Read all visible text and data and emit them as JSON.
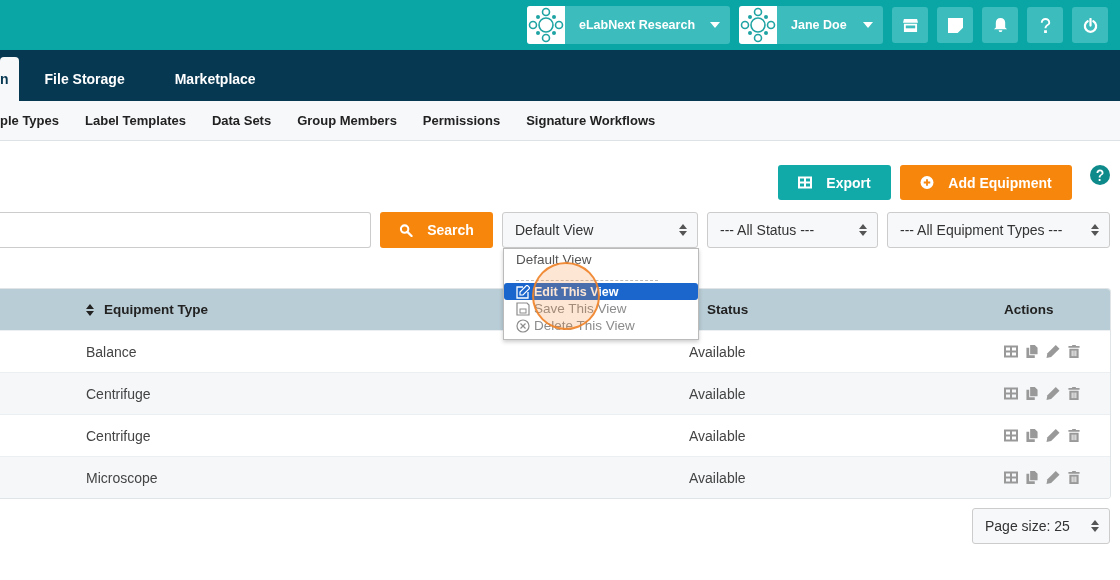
{
  "header": {
    "org": {
      "label": "eLabNext Research"
    },
    "user": {
      "label": "Jane Doe"
    }
  },
  "nav_tabs": [
    {
      "label": "n",
      "selected": true
    },
    {
      "label": "File Storage",
      "selected": false
    },
    {
      "label": "Marketplace",
      "selected": false
    }
  ],
  "sub_nav": [
    "ple Types",
    "Label Templates",
    "Data Sets",
    "Group Members",
    "Permissions",
    "Signature Workflows"
  ],
  "toolbar": {
    "export_button": "Export",
    "add_button": "Add Equipment"
  },
  "filters": {
    "search_button": "Search",
    "view_select": "Default View",
    "status_select": "--- All Status ---",
    "type_select": "--- All Equipment Types ---"
  },
  "view_menu": {
    "items": [
      {
        "kind": "option",
        "label": "Default View",
        "selected": false,
        "disabled": false
      },
      {
        "kind": "separator"
      },
      {
        "kind": "edit",
        "label": "Edit This View",
        "selected": true,
        "disabled": false
      },
      {
        "kind": "save",
        "label": "Save This View",
        "selected": false,
        "disabled": true
      },
      {
        "kind": "delete",
        "label": "Delete This View",
        "selected": false,
        "disabled": true
      }
    ]
  },
  "table": {
    "columns": [
      {
        "label": "Equipment Type",
        "sortable": true
      },
      {
        "label": "Status",
        "sortable": false
      },
      {
        "label": "Actions",
        "sortable": false
      }
    ],
    "rows": [
      {
        "equipment_type": "Balance",
        "status": "Available"
      },
      {
        "equipment_type": "Centrifuge",
        "status": "Available"
      },
      {
        "equipment_type": "Centrifuge",
        "status": "Available"
      },
      {
        "equipment_type": "Microscope",
        "status": "Available"
      }
    ]
  },
  "page_size": "Page size: 25"
}
